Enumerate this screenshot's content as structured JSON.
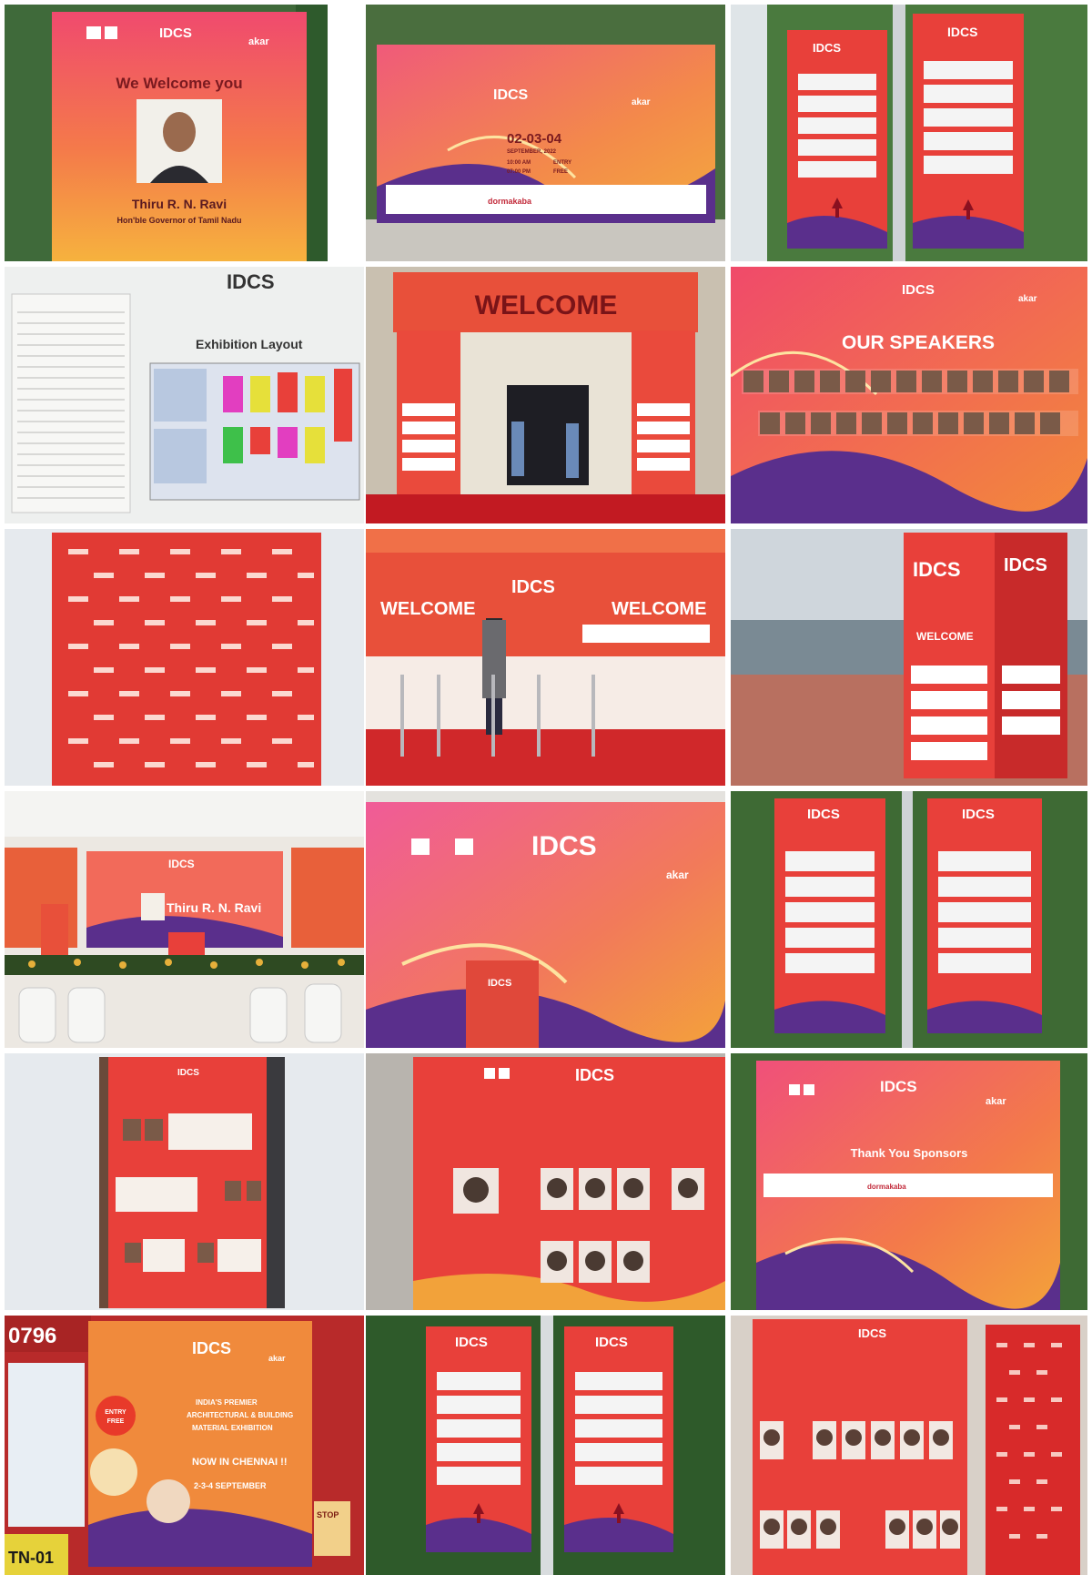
{
  "brand": {
    "logo": "IDCS",
    "sponsor_logo": "akar",
    "partner_logo": "dormakaba"
  },
  "colors": {
    "banner_red": "#e8403a",
    "banner_orange": "#f08a3c",
    "banner_pink": "#f0508a",
    "purple": "#5a2f8c",
    "foliage": "#3c6a34",
    "sky": "#dde5ec"
  },
  "panels": {
    "p1": {
      "heading": "We Welcome you",
      "name": "Thiru R. N. Ravi",
      "role": "Hon'ble Governor of Tamil Nadu"
    },
    "p2": {
      "dates": "02-03-04",
      "month": "SEPTEMBER, 2022",
      "time1": "10:00 AM",
      "time2": "07:00 PM",
      "entry": "ENTRY",
      "free": "FREE"
    },
    "p4": {
      "title": "Exhibition Layout"
    },
    "p5": {
      "banner": "WELCOME"
    },
    "p6": {
      "title": "OUR SPEAKERS"
    },
    "p8": {
      "left": "WELCOME",
      "right": "WELCOME"
    },
    "p9": {
      "label": "WELCOME"
    },
    "p10": {
      "screen_name": "Thiru R. N. Ravi"
    },
    "p15": {
      "title": "Thank You Sponsors"
    },
    "p16": {
      "plate": "TN-01",
      "number": "0796",
      "line1": "INDIA'S PREMIER",
      "line2": "ARCHITECTURAL & BUILDING",
      "line3": "MATERIAL EXHIBITION",
      "line4": "NOW IN CHENNAI !!",
      "line5": "2-3-4 SEPTEMBER",
      "badge1": "ENTRY",
      "badge2": "FREE",
      "stop": "STOP"
    }
  }
}
